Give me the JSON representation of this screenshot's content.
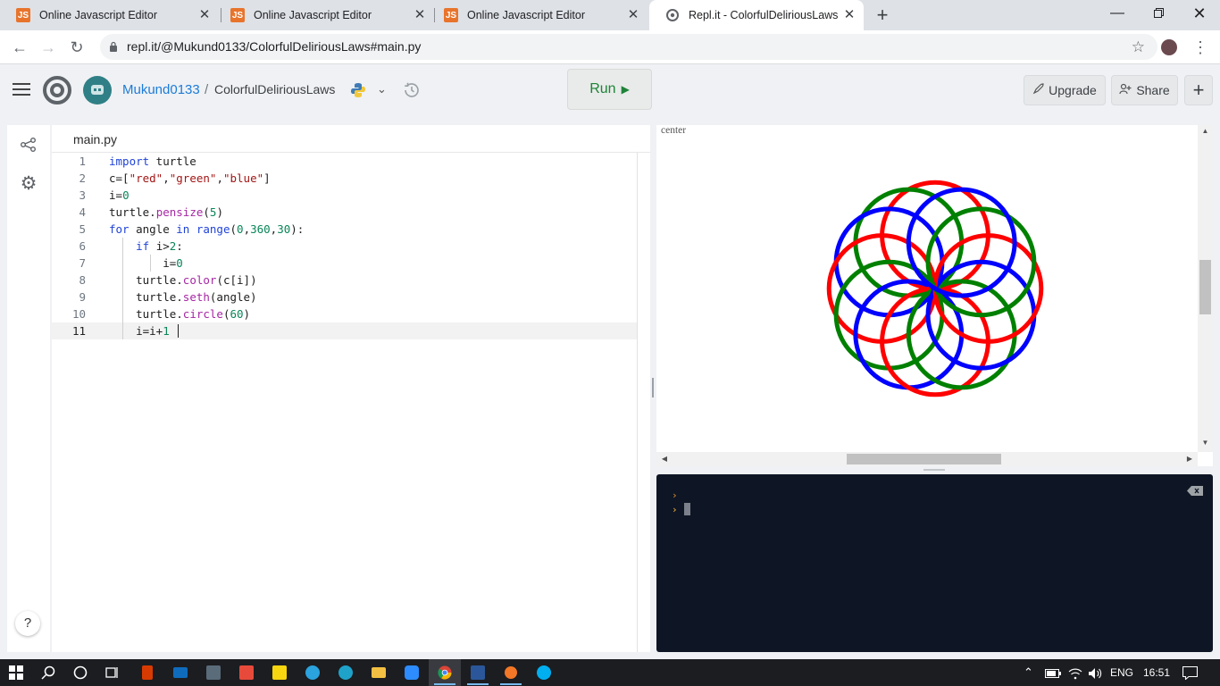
{
  "browser": {
    "tabs": [
      {
        "title": "Online Javascript Editor",
        "favicon": "js-icon",
        "active": false
      },
      {
        "title": "Online Javascript Editor",
        "favicon": "js-icon",
        "active": false
      },
      {
        "title": "Online Javascript Editor",
        "favicon": "js-icon",
        "active": false
      },
      {
        "title": "Repl.it - ColorfulDeliriousLaws",
        "favicon": "replit-icon",
        "active": true
      }
    ],
    "url": "repl.it/@Mukund0133/ColorfulDeliriousLaws#main.py"
  },
  "header": {
    "owner": "Mukund0133",
    "separator": "/",
    "repl_name": "ColorfulDeliriousLaws",
    "run_label": "Run",
    "upgrade_label": "Upgrade",
    "share_label": "Share"
  },
  "editor": {
    "file_tab": "main.py",
    "line_numbers": [
      "1",
      "2",
      "3",
      "4",
      "5",
      "6",
      "7",
      "8",
      "9",
      "10",
      "11"
    ],
    "code_lines": [
      "import turtle",
      "c=[\"red\",\"green\",\"blue\"]",
      "i=0",
      "turtle.pensize(5)",
      "for angle in range(0,360,30):",
      "    if i>2:",
      "        i=0",
      "    turtle.color(c[i])",
      "    turtle.seth(angle)",
      "    turtle.circle(60)",
      "    i=i+1 "
    ],
    "current_line": 11
  },
  "output": {
    "canvas_label": "center",
    "drawing": {
      "pen_colors": [
        "#ff0000",
        "#008000",
        "#0000ff"
      ],
      "circle_radius": 60,
      "headings_deg": [
        0,
        30,
        60,
        90,
        120,
        150,
        180,
        210,
        240,
        270,
        300,
        330
      ],
      "pen_size": 5
    }
  },
  "console": {
    "prompts": [
      "›",
      "›"
    ]
  },
  "taskbar": {
    "language": "ENG",
    "time": "16:51"
  },
  "colors": {
    "accent_blue": "#1c7bd8",
    "run_green": "#1d8338",
    "console_bg": "#0e1525"
  }
}
